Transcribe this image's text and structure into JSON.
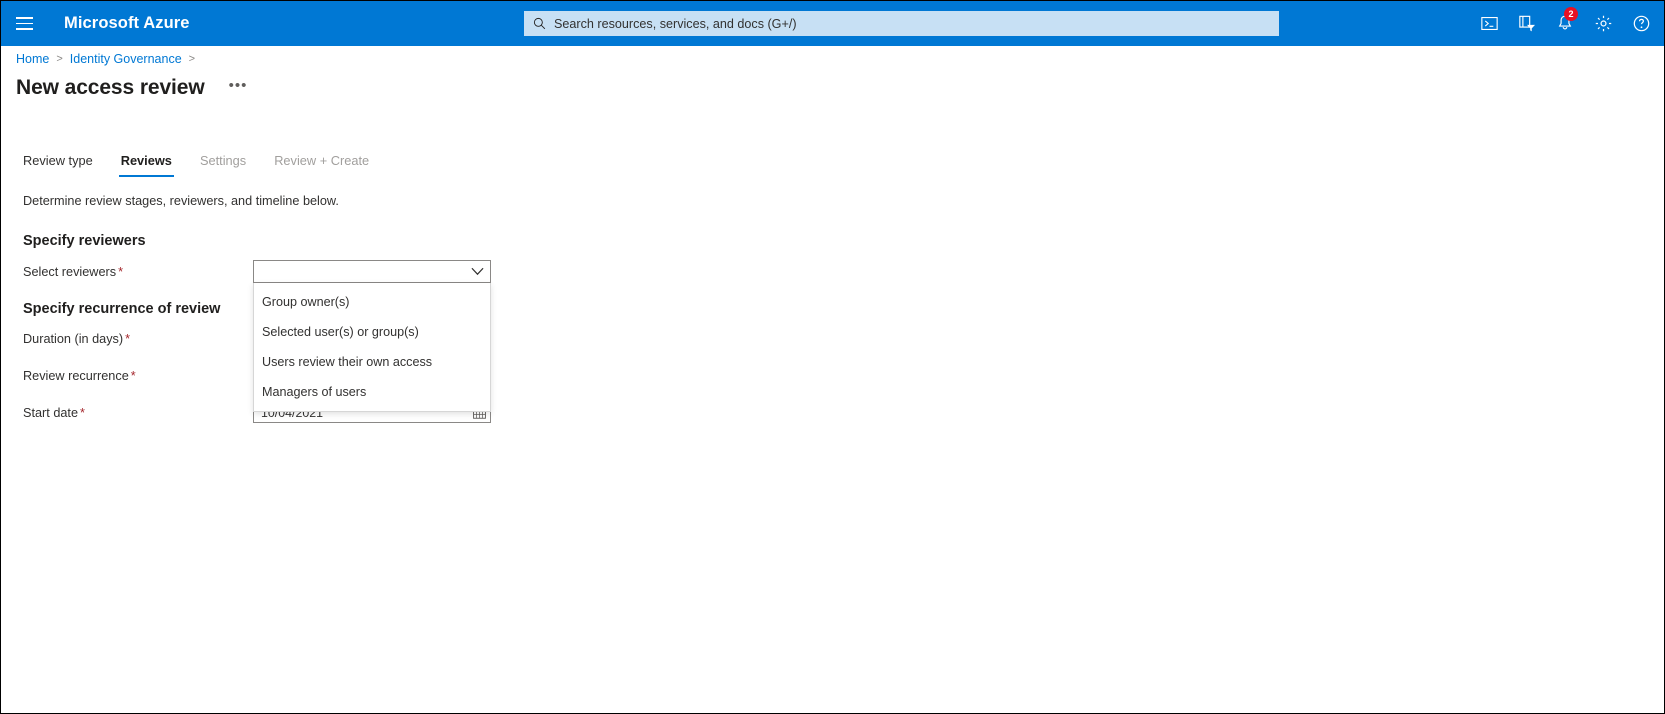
{
  "topbar": {
    "menu_icon": "hamburger-icon",
    "brand": "Microsoft Azure",
    "search": {
      "icon": "search-icon",
      "placeholder": "Search resources, services, and docs (G+/)",
      "value": ""
    },
    "icons": [
      {
        "name": "cloud-shell-icon",
        "label": "Cloud Shell"
      },
      {
        "name": "directories-subscriptions-icon",
        "label": "Directories + subscriptions"
      },
      {
        "name": "notifications-bell-icon",
        "label": "Notifications",
        "badge": "2"
      },
      {
        "name": "settings-gear-icon",
        "label": "Settings"
      },
      {
        "name": "help-question-icon",
        "label": "Help"
      }
    ],
    "accent_color": "#0078d4",
    "search_bg": "#c7e0f4",
    "badge_color": "#e81123"
  },
  "breadcrumb": {
    "items": [
      "Home",
      "Identity Governance"
    ],
    "separator": ">",
    "link_color": "#0078d4"
  },
  "page": {
    "title": "New access review",
    "more_actions": "•••"
  },
  "tabs": [
    {
      "label": "Review type",
      "state": "enabled"
    },
    {
      "label": "Reviews",
      "state": "selected"
    },
    {
      "label": "Settings",
      "state": "disabled"
    },
    {
      "label": "Review + Create",
      "state": "disabled"
    }
  ],
  "main": {
    "subtitle": "Determine review stages, reviewers, and timeline below.",
    "sections": [
      {
        "heading": "Specify reviewers"
      },
      {
        "heading": "Specify recurrence of review"
      }
    ],
    "fields": {
      "select_reviewers": {
        "label": "Select reviewers",
        "required": "*",
        "value": "",
        "chevron_icon": "chevron-down-icon"
      },
      "duration": {
        "label": "Duration (in days)",
        "required": "*"
      },
      "review_recurrence": {
        "label": "Review recurrence",
        "required": "*"
      },
      "start_date": {
        "label": "Start date",
        "required": "*",
        "value": "10/04/2021",
        "calendar_icon": "calendar-icon"
      }
    },
    "reviewer_options": [
      "Group owner(s)",
      "Selected user(s) or group(s)",
      "Users review their own access",
      "Managers of users"
    ],
    "required_marker_color": "#a4262c"
  }
}
